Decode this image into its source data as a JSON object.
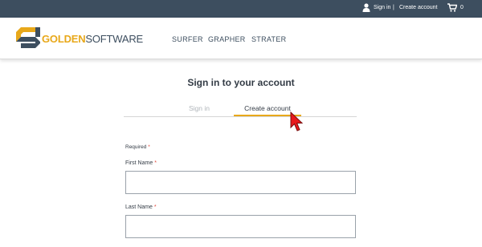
{
  "topbar": {
    "sign_in_label": "Sign in",
    "separator": "|",
    "create_account_label": "Create account",
    "cart_count": "0",
    "icons": {
      "user": "user-icon",
      "cart": "shopping-cart-icon"
    }
  },
  "header": {
    "logo": {
      "part1": "GOLDEN",
      "part2": "SOFTWARE"
    },
    "nav": [
      {
        "label": "SURFER"
      },
      {
        "label": "GRAPHER"
      },
      {
        "label": "STRATER"
      }
    ]
  },
  "main": {
    "title": "Sign in to your account",
    "tabs": [
      {
        "label": "Sign in",
        "active": false
      },
      {
        "label": "Create account",
        "active": true
      }
    ],
    "required_note": "Required",
    "required_mark": "*",
    "fields": [
      {
        "label": "First Name",
        "value": ""
      },
      {
        "label": "Last Name",
        "value": ""
      }
    ]
  },
  "colors": {
    "topbar_bg": "#3d4e5f",
    "accent": "#e8a81a",
    "required_star": "#e0483b",
    "cursor": "#e8191c"
  }
}
